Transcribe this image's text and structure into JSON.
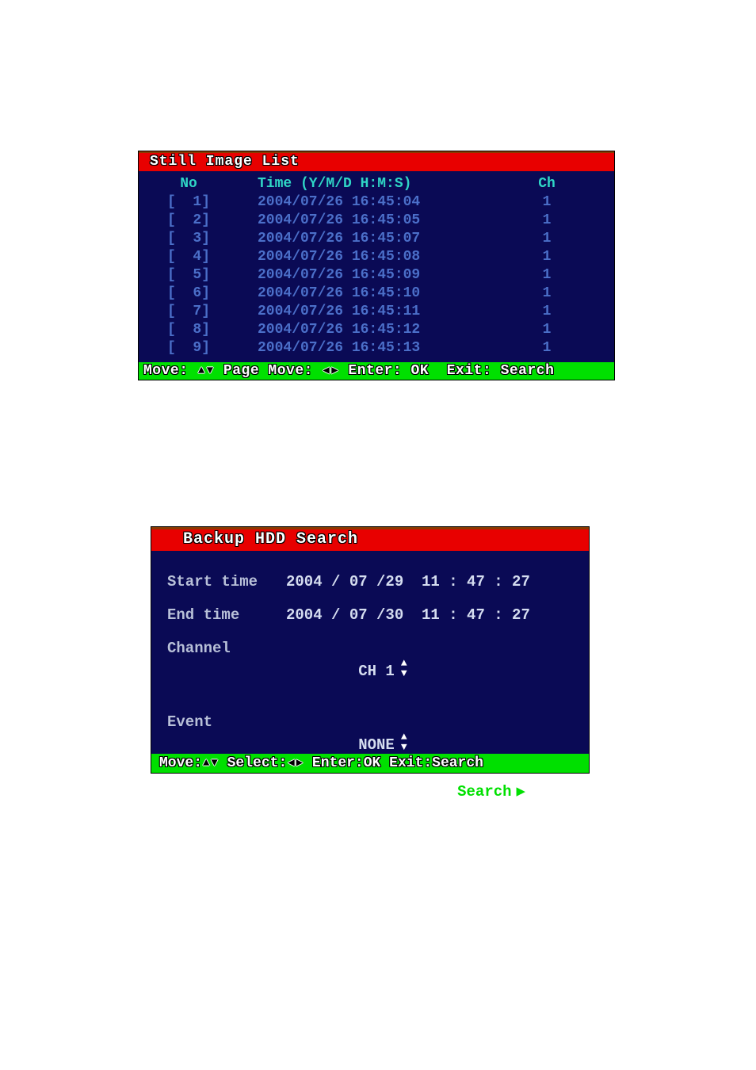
{
  "panel1": {
    "title": "Still Image List",
    "columns": {
      "no": "No",
      "time": "Time (Y/M/D H:M:S)",
      "ch": "Ch"
    },
    "rows": [
      {
        "no": "[  1]",
        "time": "2004/07/26 16:45:04",
        "ch": "1"
      },
      {
        "no": "[  2]",
        "time": "2004/07/26 16:45:05",
        "ch": "1"
      },
      {
        "no": "[  3]",
        "time": "2004/07/26 16:45:07",
        "ch": "1"
      },
      {
        "no": "[  4]",
        "time": "2004/07/26 16:45:08",
        "ch": "1"
      },
      {
        "no": "[  5]",
        "time": "2004/07/26 16:45:09",
        "ch": "1"
      },
      {
        "no": "[  6]",
        "time": "2004/07/26 16:45:10",
        "ch": "1"
      },
      {
        "no": "[  7]",
        "time": "2004/07/26 16:45:11",
        "ch": "1"
      },
      {
        "no": "[  8]",
        "time": "2004/07/26 16:45:12",
        "ch": "1"
      },
      {
        "no": "[  9]",
        "time": "2004/07/26 16:45:13",
        "ch": "1"
      }
    ],
    "footer": {
      "move": "Move: ",
      "page_move": " Page Move: ",
      "enter": " Enter: OK ",
      "exit": " Exit: Search"
    }
  },
  "panel2": {
    "title": "Backup HDD Search",
    "start_label": "Start time",
    "start_value": "2004 / 07 /29  11 : 47 : 27",
    "end_label": "End time",
    "end_value": "2004 / 07 /30  11 : 47 : 27",
    "channel_label": "Channel",
    "channel_value": "CH 1",
    "event_label": "Event",
    "event_value": "NONE",
    "search_label": "Search",
    "footer": {
      "move": "Move:",
      "select": " Select:",
      "enter": " Enter:OK",
      "exit": " Exit:Search"
    }
  }
}
